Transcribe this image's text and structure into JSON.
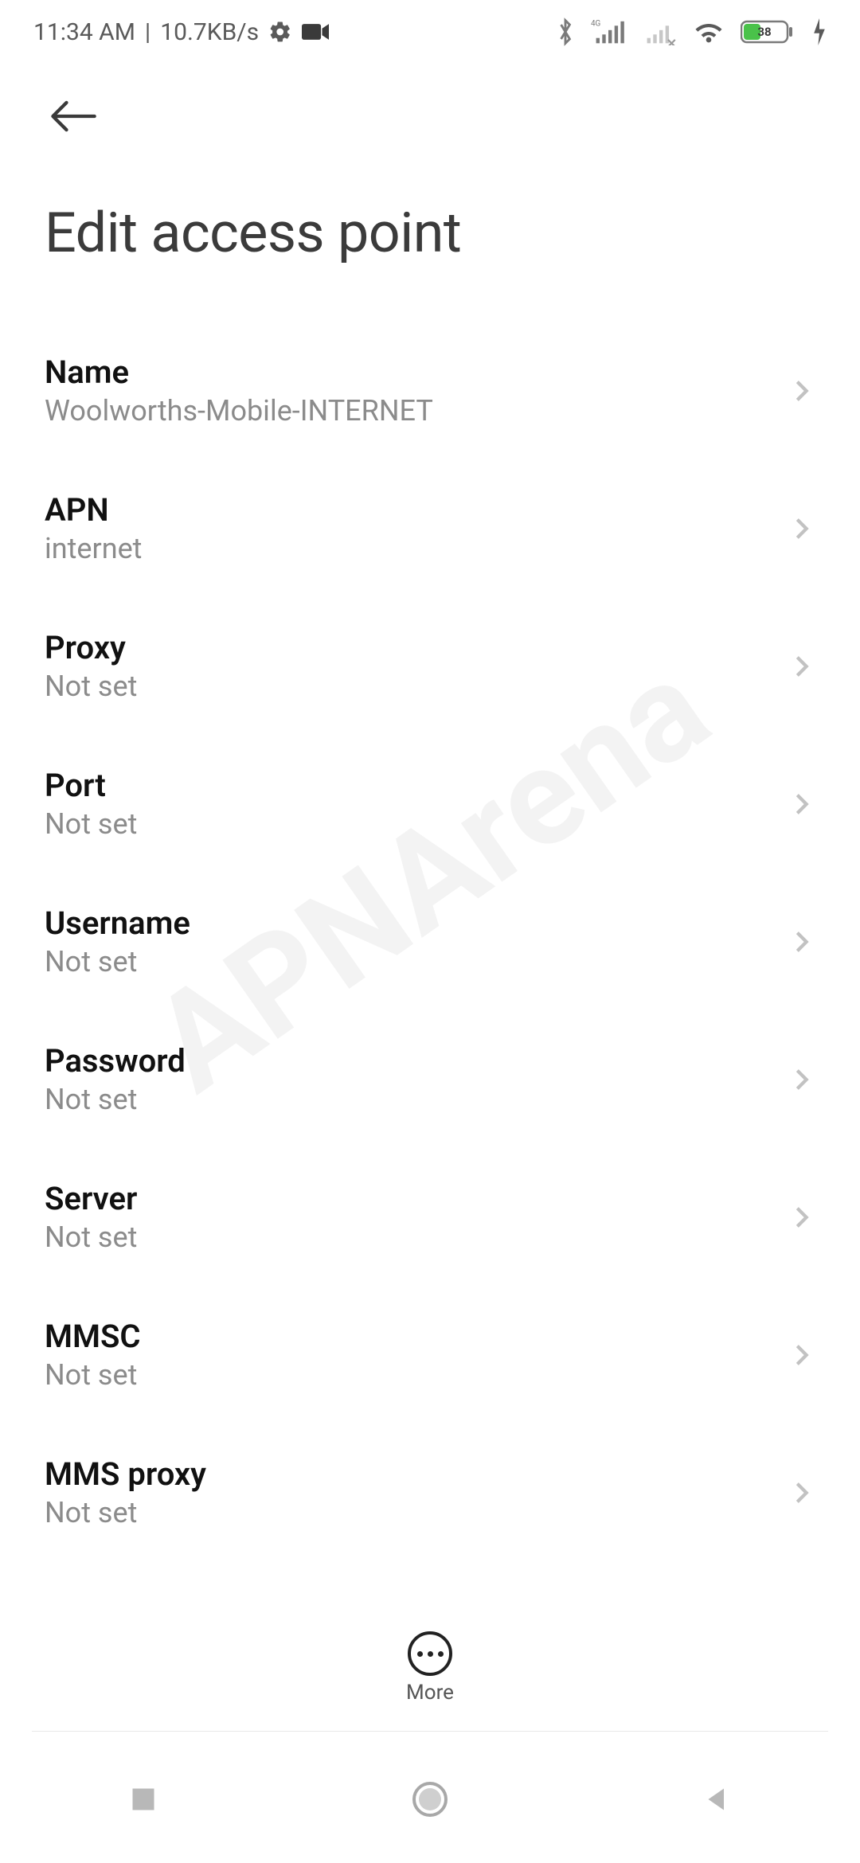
{
  "statusbar": {
    "time": "11:34 AM",
    "sep": "|",
    "netspeed": "10.7KB/s",
    "battery_pct": "38"
  },
  "header": {
    "title": "Edit access point"
  },
  "rows": [
    {
      "title": "Name",
      "sub": "Woolworths-Mobile-INTERNET"
    },
    {
      "title": "APN",
      "sub": "internet"
    },
    {
      "title": "Proxy",
      "sub": "Not set"
    },
    {
      "title": "Port",
      "sub": "Not set"
    },
    {
      "title": "Username",
      "sub": "Not set"
    },
    {
      "title": "Password",
      "sub": "Not set"
    },
    {
      "title": "Server",
      "sub": "Not set"
    },
    {
      "title": "MMSC",
      "sub": "Not set"
    },
    {
      "title": "MMS proxy",
      "sub": "Not set"
    }
  ],
  "more": {
    "label": "More"
  },
  "watermark": "APNArena"
}
